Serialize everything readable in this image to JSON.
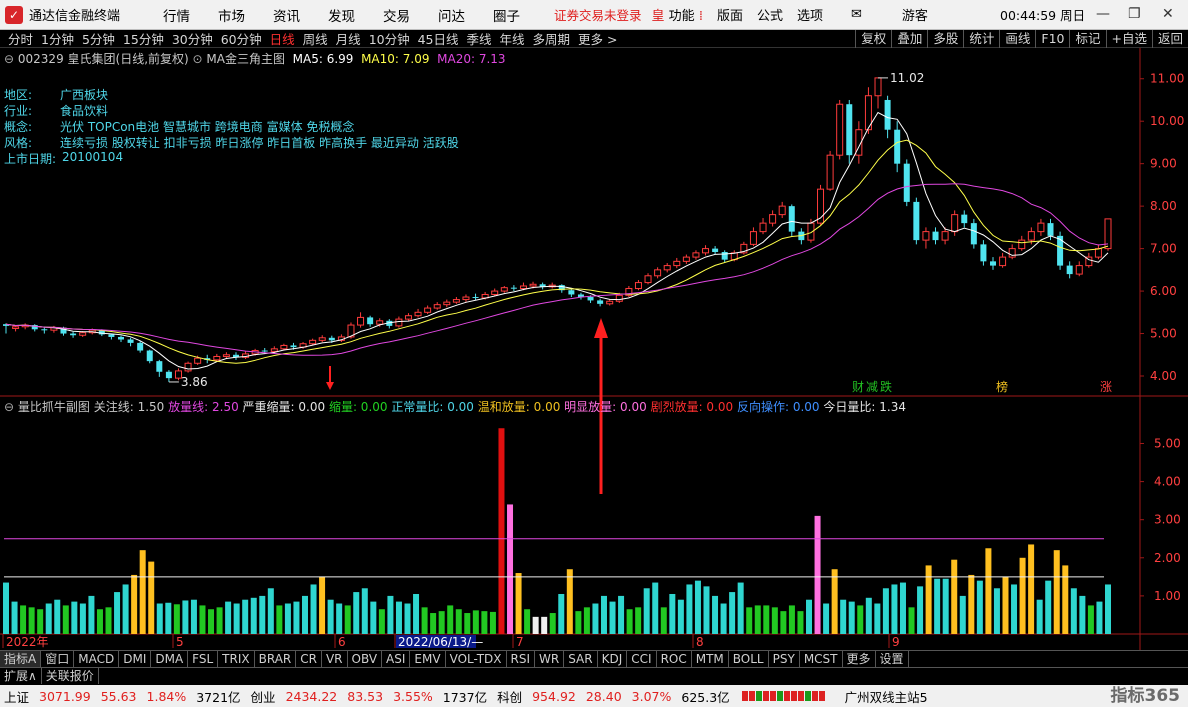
{
  "app": {
    "name": "通达信金融终端",
    "menu": [
      "行情",
      "市场",
      "资讯",
      "发现",
      "交易",
      "问达",
      "圈子"
    ],
    "warning": "证券交易未登录",
    "feature_glyph": "皇",
    "feature_label": "功能",
    "toolbar": [
      "版面",
      "公式",
      "选项"
    ],
    "user": "游客",
    "clock": "00:44:59 周日"
  },
  "periods": [
    "分时",
    "1分钟",
    "5分钟",
    "15分钟",
    "30分钟",
    "60分钟",
    "日线",
    "周线",
    "月线",
    "10分钟",
    "45日线",
    "季线",
    "年线",
    "多周期",
    "更多 >"
  ],
  "active_period": "日线",
  "right_tools": [
    "复权",
    "叠加",
    "多股",
    "统计",
    "画线",
    "F10",
    "标记",
    "+自选",
    "返回"
  ],
  "stock": {
    "title": "002329 皇氏集团(日线,前复权)",
    "indicator": "MA金三角主图",
    "ma5": "MA5: 6.99",
    "ma10": "MA10: 7.09",
    "ma20": "MA20: 7.13",
    "region_label": "地区:",
    "region": "广西板块",
    "industry_label": "行业:",
    "industry": "食品饮料",
    "concept_label": "概念:",
    "concept": "光伏 TOPCon电池 智慧城市 跨境电商 富媒体 免税概念",
    "style_label": "风格:",
    "style": "连续亏损 股权转让 扣非亏损 昨日涨停 昨日首板 昨高换手 最近异动 活跃股",
    "listing_label": "上市日期:",
    "listing": "20100104",
    "high_label": "11.02",
    "low_label": "3.86",
    "markers": [
      "财",
      "减",
      "跌",
      "榜",
      "涨"
    ]
  },
  "sub": {
    "name": "量比抓牛副图",
    "focus": "关注线: 1.50",
    "expand": "放量线: 2.50",
    "severe": "严重缩量: 0.00",
    "shrink": "缩量: 0.00",
    "normal": "正常量比: 0.00",
    "mild": "温和放量: 0.00",
    "obvious": "明显放量: 0.00",
    "sharp": "剧烈放量: 0.00",
    "reverse": "反向操作: 0.00",
    "today": "今日量比: 1.34"
  },
  "price_axis": [
    "11.00",
    "10.00",
    "9.00",
    "8.00",
    "7.00",
    "6.00",
    "5.00",
    "4.00"
  ],
  "vol_axis": [
    "5.00",
    "4.00",
    "3.00",
    "2.00",
    "1.00"
  ],
  "date_axis": [
    "2022年",
    "5",
    "6",
    "2022/06/13/—",
    "7",
    "8",
    "9"
  ],
  "tabs": [
    "指标A",
    "窗口",
    "MACD",
    "DMI",
    "DMA",
    "FSL",
    "TRIX",
    "BRAR",
    "CR",
    "VR",
    "OBV",
    "ASI",
    "EMV",
    "VOL-TDX",
    "RSI",
    "WR",
    "SAR",
    "KDJ",
    "CCI",
    "ROC",
    "MTM",
    "BOLL",
    "PSY",
    "MCST",
    "更多",
    "设置"
  ],
  "tabs2": [
    "扩展∧",
    "关联报价"
  ],
  "status": {
    "sh_name": "上证",
    "sh_val": "3071.99",
    "sh_chg": "55.63",
    "sh_pct": "1.84%",
    "sh_amt": "3721亿",
    "cy_name": "创业",
    "cy_val": "2434.22",
    "cy_chg": "83.53",
    "cy_pct": "3.55%",
    "cy_amt": "1737亿",
    "kc_name": "科创",
    "kc_val": "954.92",
    "kc_chg": "28.40",
    "kc_pct": "3.07%",
    "kc_amt": "625.3亿",
    "server": "广州双线主站5",
    "brand": "指标365"
  },
  "chart_data": {
    "type": "candlestick",
    "candles": [
      [
        5.18,
        5.22,
        5.0,
        5.24,
        "down"
      ],
      [
        5.12,
        5.16,
        5.05,
        5.2,
        "up"
      ],
      [
        5.16,
        5.2,
        5.1,
        5.24,
        "up"
      ],
      [
        5.2,
        5.1,
        5.05,
        5.22,
        "down"
      ],
      [
        5.1,
        5.08,
        5.0,
        5.14,
        "down"
      ],
      [
        5.08,
        5.14,
        5.02,
        5.18,
        "up"
      ],
      [
        5.14,
        5.0,
        4.95,
        5.16,
        "down"
      ],
      [
        5.0,
        4.96,
        4.9,
        5.04,
        "down"
      ],
      [
        4.96,
        5.02,
        4.92,
        5.06,
        "up"
      ],
      [
        5.02,
        5.08,
        4.98,
        5.12,
        "up"
      ],
      [
        5.08,
        4.98,
        4.94,
        5.1,
        "down"
      ],
      [
        4.98,
        4.92,
        4.86,
        5.0,
        "down"
      ],
      [
        4.92,
        4.86,
        4.8,
        4.95,
        "down"
      ],
      [
        4.86,
        4.78,
        4.7,
        4.9,
        "down"
      ],
      [
        4.78,
        4.6,
        4.55,
        4.82,
        "down"
      ],
      [
        4.6,
        4.35,
        4.3,
        4.62,
        "down"
      ],
      [
        4.35,
        4.1,
        3.98,
        4.38,
        "down"
      ],
      [
        4.1,
        3.95,
        3.86,
        4.14,
        "down"
      ],
      [
        3.95,
        4.12,
        3.9,
        4.18,
        "up"
      ],
      [
        4.12,
        4.3,
        4.08,
        4.34,
        "up"
      ],
      [
        4.3,
        4.42,
        4.26,
        4.48,
        "up"
      ],
      [
        4.42,
        4.38,
        4.3,
        4.5,
        "down"
      ],
      [
        4.38,
        4.46,
        4.34,
        4.52,
        "up"
      ],
      [
        4.46,
        4.5,
        4.4,
        4.56,
        "up"
      ],
      [
        4.5,
        4.44,
        4.38,
        4.56,
        "down"
      ],
      [
        4.44,
        4.52,
        4.4,
        4.58,
        "up"
      ],
      [
        4.52,
        4.6,
        4.48,
        4.64,
        "up"
      ],
      [
        4.6,
        4.58,
        4.52,
        4.66,
        "down"
      ],
      [
        4.58,
        4.64,
        4.54,
        4.7,
        "up"
      ],
      [
        4.64,
        4.72,
        4.6,
        4.76,
        "up"
      ],
      [
        4.72,
        4.68,
        4.62,
        4.78,
        "down"
      ],
      [
        4.68,
        4.76,
        4.64,
        4.8,
        "up"
      ],
      [
        4.76,
        4.84,
        4.72,
        4.88,
        "up"
      ],
      [
        4.84,
        4.9,
        4.8,
        4.96,
        "up"
      ],
      [
        4.9,
        4.84,
        4.78,
        4.95,
        "down"
      ],
      [
        4.84,
        4.92,
        4.8,
        4.98,
        "up"
      ],
      [
        4.92,
        5.2,
        4.88,
        5.26,
        "up"
      ],
      [
        5.2,
        5.38,
        5.14,
        5.5,
        "up"
      ],
      [
        5.38,
        5.22,
        5.16,
        5.42,
        "down"
      ],
      [
        5.22,
        5.3,
        5.16,
        5.36,
        "up"
      ],
      [
        5.3,
        5.18,
        5.12,
        5.34,
        "down"
      ],
      [
        5.18,
        5.34,
        5.14,
        5.4,
        "up"
      ],
      [
        5.34,
        5.42,
        5.3,
        5.48,
        "up"
      ],
      [
        5.42,
        5.5,
        5.38,
        5.58,
        "up"
      ],
      [
        5.5,
        5.6,
        5.46,
        5.66,
        "up"
      ],
      [
        5.6,
        5.68,
        5.56,
        5.74,
        "up"
      ],
      [
        5.68,
        5.74,
        5.62,
        5.8,
        "up"
      ],
      [
        5.74,
        5.8,
        5.7,
        5.86,
        "up"
      ],
      [
        5.8,
        5.86,
        5.74,
        5.92,
        "up"
      ],
      [
        5.86,
        5.84,
        5.78,
        5.94,
        "down"
      ],
      [
        5.84,
        5.92,
        5.8,
        5.98,
        "up"
      ],
      [
        5.92,
        6.0,
        5.88,
        6.06,
        "up"
      ],
      [
        6.0,
        6.08,
        5.96,
        6.12,
        "up"
      ],
      [
        6.08,
        6.06,
        6.0,
        6.14,
        "down"
      ],
      [
        6.06,
        6.12,
        6.02,
        6.2,
        "up"
      ],
      [
        6.12,
        6.16,
        6.06,
        6.22,
        "up"
      ],
      [
        6.16,
        6.1,
        6.04,
        6.2,
        "down"
      ],
      [
        6.1,
        6.14,
        6.06,
        6.2,
        "up"
      ],
      [
        6.14,
        6.02,
        5.96,
        6.16,
        "down"
      ],
      [
        6.02,
        5.92,
        5.86,
        6.04,
        "down"
      ],
      [
        5.92,
        5.86,
        5.8,
        5.96,
        "down"
      ],
      [
        5.86,
        5.78,
        5.72,
        5.9,
        "down"
      ],
      [
        5.78,
        5.7,
        5.64,
        5.82,
        "down"
      ],
      [
        5.7,
        5.76,
        5.66,
        5.8,
        "up"
      ],
      [
        5.76,
        5.9,
        5.72,
        5.96,
        "up"
      ],
      [
        5.9,
        6.06,
        5.86,
        6.12,
        "up"
      ],
      [
        6.06,
        6.2,
        6.02,
        6.26,
        "up"
      ],
      [
        6.2,
        6.36,
        6.16,
        6.42,
        "up"
      ],
      [
        6.36,
        6.5,
        6.3,
        6.56,
        "up"
      ],
      [
        6.5,
        6.6,
        6.44,
        6.66,
        "up"
      ],
      [
        6.6,
        6.7,
        6.54,
        6.78,
        "up"
      ],
      [
        6.7,
        6.8,
        6.64,
        6.86,
        "up"
      ],
      [
        6.8,
        6.9,
        6.74,
        6.96,
        "up"
      ],
      [
        6.9,
        7.0,
        6.84,
        7.08,
        "up"
      ],
      [
        7.0,
        6.92,
        6.86,
        7.06,
        "down"
      ],
      [
        6.92,
        6.74,
        6.68,
        6.96,
        "down"
      ],
      [
        6.74,
        6.9,
        6.7,
        6.96,
        "up"
      ],
      [
        6.9,
        7.1,
        6.86,
        7.16,
        "up"
      ],
      [
        7.1,
        7.4,
        7.06,
        7.5,
        "up"
      ],
      [
        7.4,
        7.6,
        7.34,
        7.72,
        "up"
      ],
      [
        7.6,
        7.8,
        7.52,
        7.9,
        "up"
      ],
      [
        7.8,
        8.0,
        7.72,
        8.1,
        "up"
      ],
      [
        8.0,
        7.4,
        7.3,
        8.04,
        "down"
      ],
      [
        7.4,
        7.2,
        7.1,
        7.48,
        "down"
      ],
      [
        7.2,
        7.6,
        7.14,
        7.7,
        "up"
      ],
      [
        7.6,
        8.4,
        7.56,
        8.5,
        "up"
      ],
      [
        8.4,
        9.2,
        8.36,
        9.3,
        "up"
      ],
      [
        9.2,
        10.4,
        9.1,
        10.5,
        "up"
      ],
      [
        10.4,
        9.2,
        9.0,
        10.5,
        "down"
      ],
      [
        9.2,
        9.8,
        9.0,
        10.0,
        "up"
      ],
      [
        9.8,
        10.6,
        9.7,
        10.8,
        "up"
      ],
      [
        10.6,
        11.02,
        10.3,
        11.02,
        "up"
      ],
      [
        10.5,
        9.8,
        9.6,
        10.6,
        "down"
      ],
      [
        9.8,
        9.0,
        8.8,
        10.0,
        "down"
      ],
      [
        9.0,
        8.1,
        8.0,
        9.1,
        "down"
      ],
      [
        8.1,
        7.2,
        7.1,
        8.2,
        "down"
      ],
      [
        7.2,
        7.4,
        7.0,
        7.5,
        "up"
      ],
      [
        7.4,
        7.2,
        7.1,
        7.5,
        "down"
      ],
      [
        7.2,
        7.4,
        7.1,
        7.5,
        "up"
      ],
      [
        7.4,
        7.8,
        7.3,
        7.9,
        "up"
      ],
      [
        7.8,
        7.6,
        7.5,
        7.9,
        "down"
      ],
      [
        7.6,
        7.1,
        7.0,
        7.7,
        "down"
      ],
      [
        7.1,
        6.7,
        6.6,
        7.2,
        "down"
      ],
      [
        6.7,
        6.6,
        6.5,
        6.8,
        "down"
      ],
      [
        6.6,
        6.8,
        6.55,
        6.9,
        "up"
      ],
      [
        6.8,
        7.0,
        6.75,
        7.1,
        "up"
      ],
      [
        7.0,
        7.2,
        6.95,
        7.3,
        "up"
      ],
      [
        7.2,
        7.4,
        7.1,
        7.5,
        "up"
      ],
      [
        7.4,
        7.6,
        7.3,
        7.7,
        "up"
      ],
      [
        7.6,
        7.3,
        7.2,
        7.7,
        "down"
      ],
      [
        7.3,
        6.6,
        6.5,
        7.4,
        "down"
      ],
      [
        6.6,
        6.4,
        6.3,
        6.7,
        "down"
      ],
      [
        6.4,
        6.6,
        6.35,
        6.7,
        "up"
      ],
      [
        6.6,
        6.8,
        6.55,
        6.9,
        "up"
      ],
      [
        6.8,
        7.0,
        6.75,
        7.1,
        "up"
      ],
      [
        7.0,
        7.7,
        6.95,
        7.7,
        "up"
      ]
    ],
    "volume_ratio": [
      1.35,
      0.85,
      0.75,
      0.7,
      0.65,
      0.8,
      0.9,
      0.75,
      0.85,
      0.8,
      1.0,
      0.65,
      0.7,
      1.1,
      1.3,
      1.55,
      2.2,
      1.9,
      0.8,
      0.82,
      0.78,
      0.88,
      0.9,
      0.75,
      0.65,
      0.7,
      0.85,
      0.8,
      0.9,
      0.95,
      1.0,
      1.2,
      0.75,
      0.8,
      0.85,
      1.0,
      1.3,
      1.5,
      0.9,
      0.8,
      0.75,
      1.1,
      1.2,
      0.85,
      0.65,
      1.0,
      0.85,
      0.8,
      1.05,
      0.7,
      0.55,
      0.6,
      0.75,
      0.65,
      0.55,
      0.62,
      0.6,
      0.58,
      5.4,
      3.4,
      1.6,
      0.65,
      0.45,
      0.45,
      0.55,
      1.05,
      1.7,
      0.6,
      0.7,
      0.8,
      1.0,
      0.85,
      1.0,
      0.65,
      0.7,
      1.2,
      1.35,
      0.7,
      1.05,
      0.9,
      1.3,
      1.4,
      1.25,
      1.0,
      0.8,
      1.1,
      1.35,
      0.7,
      0.75,
      0.75,
      0.7,
      0.6,
      0.75,
      0.6,
      0.9,
      3.1,
      0.8,
      1.7,
      0.9,
      0.85,
      0.75,
      0.95,
      0.8,
      1.2,
      1.3,
      1.35,
      0.7,
      1.25,
      1.8,
      1.45,
      1.45,
      1.95,
      1.0,
      1.55,
      1.4,
      2.25,
      1.2,
      1.5,
      1.3,
      2.0,
      2.35,
      0.9,
      1.4,
      2.2,
      1.8,
      1.2,
      1.0,
      0.75,
      0.85,
      1.3
    ],
    "focus_line": 1.5,
    "expand_line": 2.5,
    "ylim_price": [
      3.6,
      11.3
    ],
    "ylim_vol": [
      0,
      5.8
    ]
  }
}
